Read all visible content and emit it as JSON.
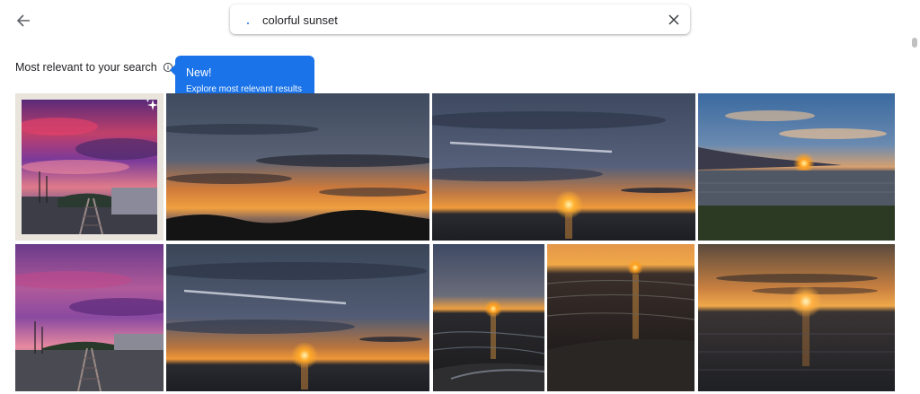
{
  "search": {
    "query": "colorful sunset"
  },
  "results": {
    "section_title": "Most relevant to your search",
    "tooltip": {
      "title": "New!",
      "body": "Explore most relevant results"
    }
  },
  "colors": {
    "accent": "#1a73e8",
    "text": "#202124",
    "icon": "#5f6368"
  },
  "photos": [
    {
      "name": "photo-stylized-railway-sunset",
      "alt": "Stylized purple sunset over railway tracks"
    },
    {
      "name": "photo-coast-sunset-clouds",
      "alt": "Orange sunset under layered clouds over coast"
    },
    {
      "name": "photo-ocean-sunset-contrail",
      "alt": "Sun setting over ocean with contrail"
    },
    {
      "name": "photo-island-sunset-sea",
      "alt": "Sun setting behind island over sea"
    },
    {
      "name": "photo-railway-sunset-purple",
      "alt": "Purple sky over railway tracks"
    },
    {
      "name": "photo-ocean-sunset-contrail-2",
      "alt": "Sun setting over ocean with contrail"
    },
    {
      "name": "photo-beach-sunset-waves",
      "alt": "Sun setting over beach waves"
    },
    {
      "name": "photo-beach-sunset-reflection",
      "alt": "Sun reflection on beach at sunset"
    },
    {
      "name": "photo-sea-sunset-orange",
      "alt": "Orange sunset over sea"
    }
  ]
}
